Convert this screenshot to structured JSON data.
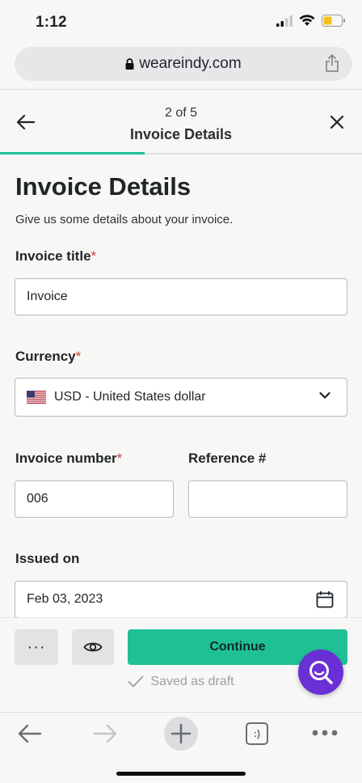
{
  "status": {
    "time": "1:12"
  },
  "browser": {
    "url": "weareindy.com"
  },
  "header": {
    "step": "2 of 5",
    "title": "Invoice Details",
    "progress": 0.4
  },
  "page": {
    "title": "Invoice Details",
    "subtitle": "Give us some details about your invoice."
  },
  "form": {
    "invoice_title": {
      "label": "Invoice title",
      "required": "*",
      "value": "Invoice"
    },
    "currency": {
      "label": "Currency",
      "required": "*",
      "value": "USD - United States dollar"
    },
    "invoice_number": {
      "label": "Invoice number",
      "required": "*",
      "value": "006"
    },
    "reference": {
      "label": "Reference #",
      "value": ""
    },
    "issued_on": {
      "label": "Issued on",
      "value": "Feb 03, 2023"
    }
  },
  "actions": {
    "more_label": "···",
    "continue_label": "Continue",
    "saved_label": "Saved as draft"
  },
  "browser_bar": {
    "tabs_label": ":)"
  },
  "colors": {
    "accent": "#20c097",
    "fab": "#6b2fd6",
    "required": "#d63a3a"
  }
}
